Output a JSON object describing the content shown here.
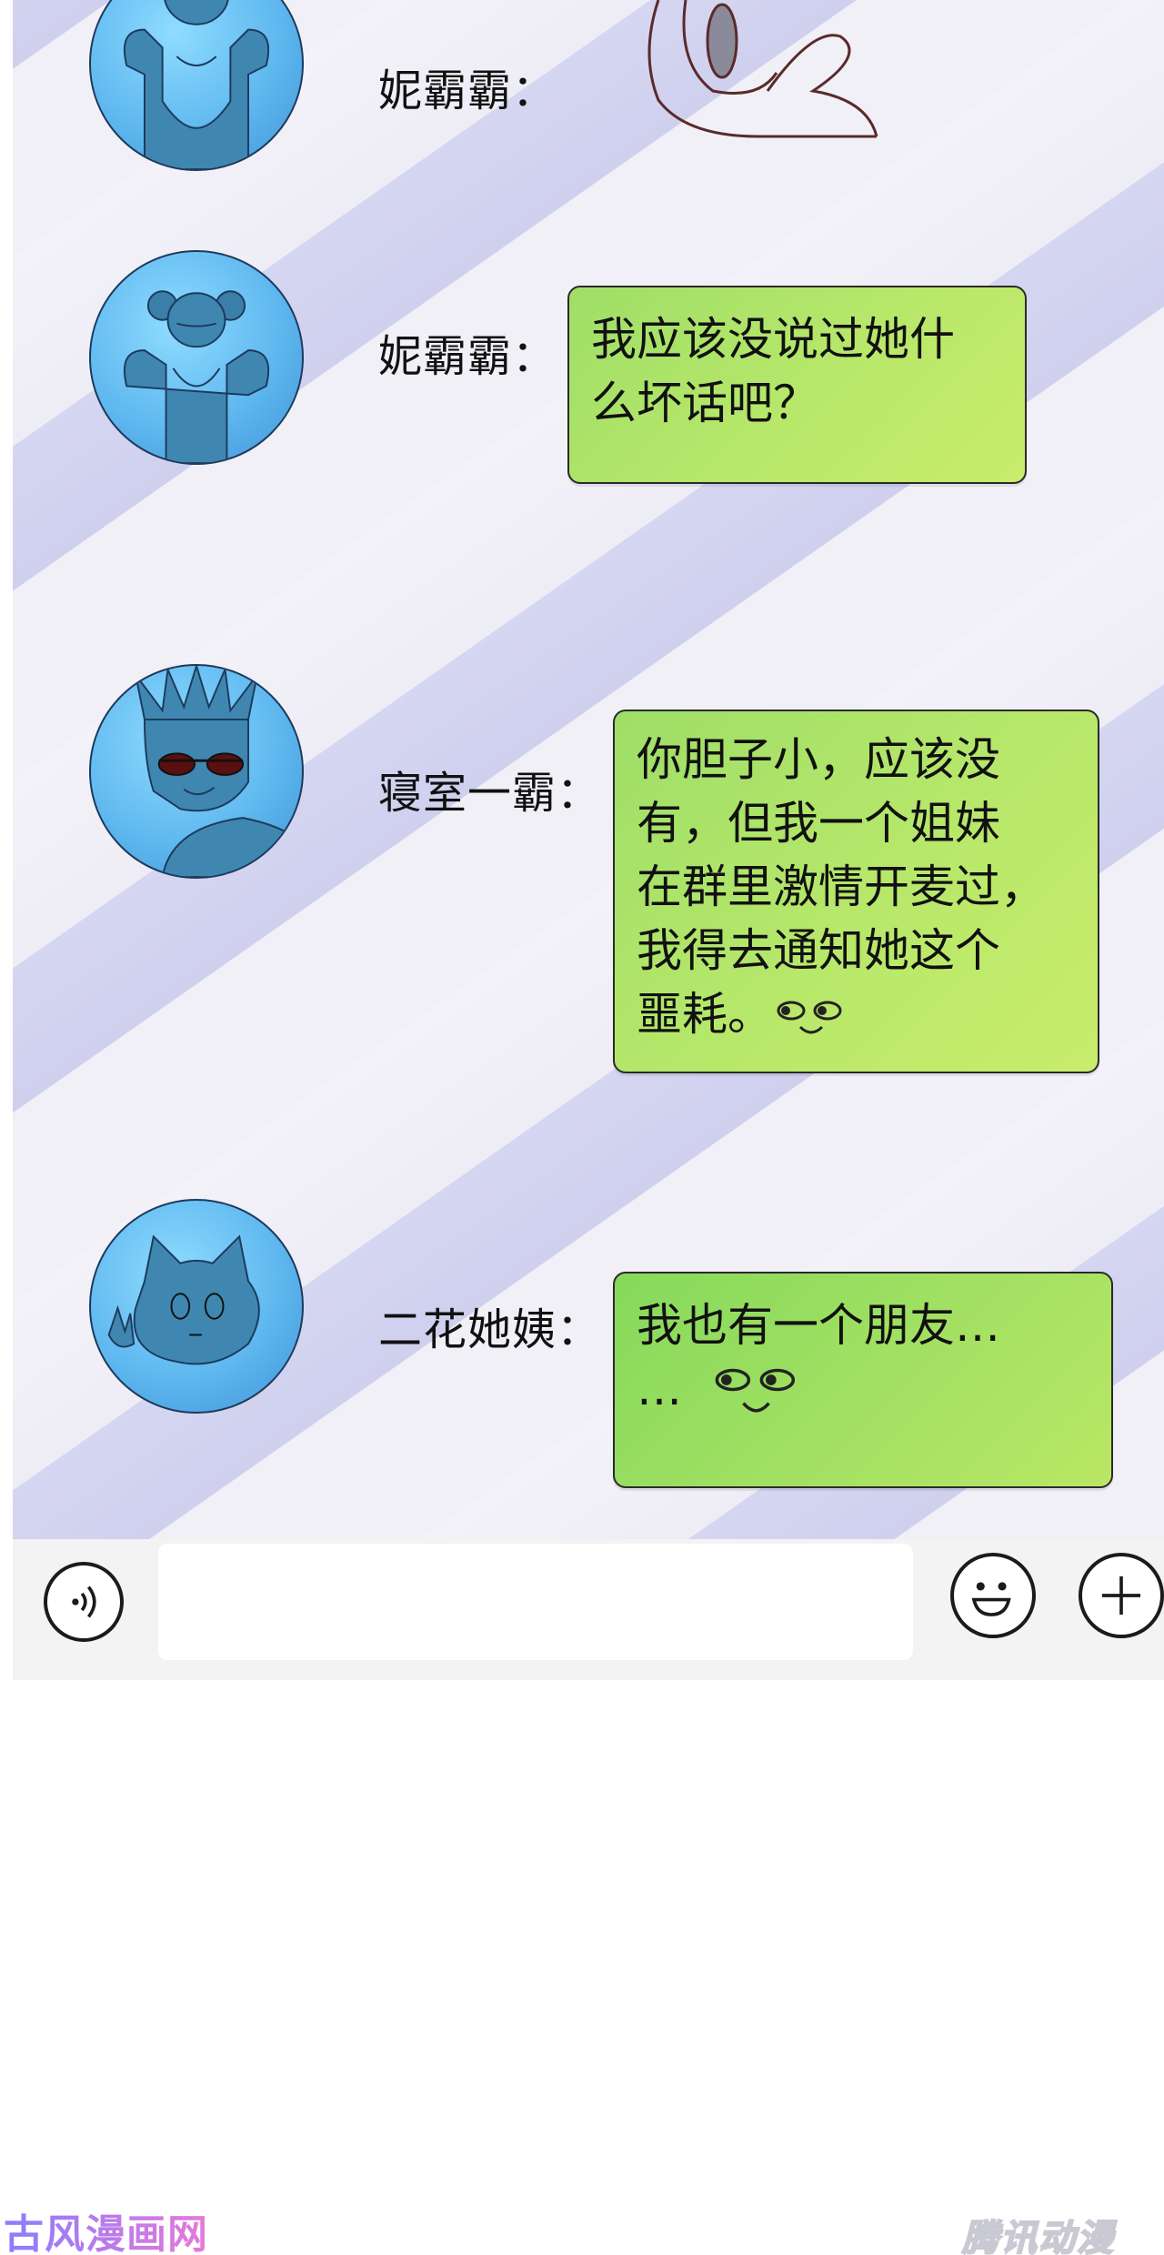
{
  "messages": [
    {
      "sender": "妮霸霸：",
      "text": "",
      "avatar": "girl-pigtails-avatar",
      "sticker": "doodle-sticker"
    },
    {
      "sender": "妮霸霸：",
      "lines": [
        "我应该没说过她什",
        "么坏话吧？"
      ],
      "avatar": "girl-pigtails-avatar"
    },
    {
      "sender": "寝室一霸：",
      "lines": [
        "你胆子小，应该没",
        "有，但我一个姐妹",
        "在群里激情开麦过，",
        "我得去通知她这个",
        "噩耗。"
      ],
      "avatar": "spiky-hair-sunglasses-avatar",
      "emoji": "smirk-face"
    },
    {
      "sender": "二花她姨：",
      "lines": [
        "我也有一个朋友…",
        "…"
      ],
      "avatar": "cat-blob-avatar",
      "emoji": "smirk-face"
    }
  ],
  "input": {
    "placeholder": "",
    "value": ""
  },
  "icons": {
    "voice": "voice-icon",
    "emoji": "emoji-icon",
    "plus": "plus-icon"
  },
  "watermarks": {
    "left": "古风漫画网",
    "right": "腾讯动漫"
  },
  "colors": {
    "bubble_green": "#b8e86a",
    "avatar_blue": "#5fb8ef",
    "stripe_lavender": "#d5d6f1"
  }
}
